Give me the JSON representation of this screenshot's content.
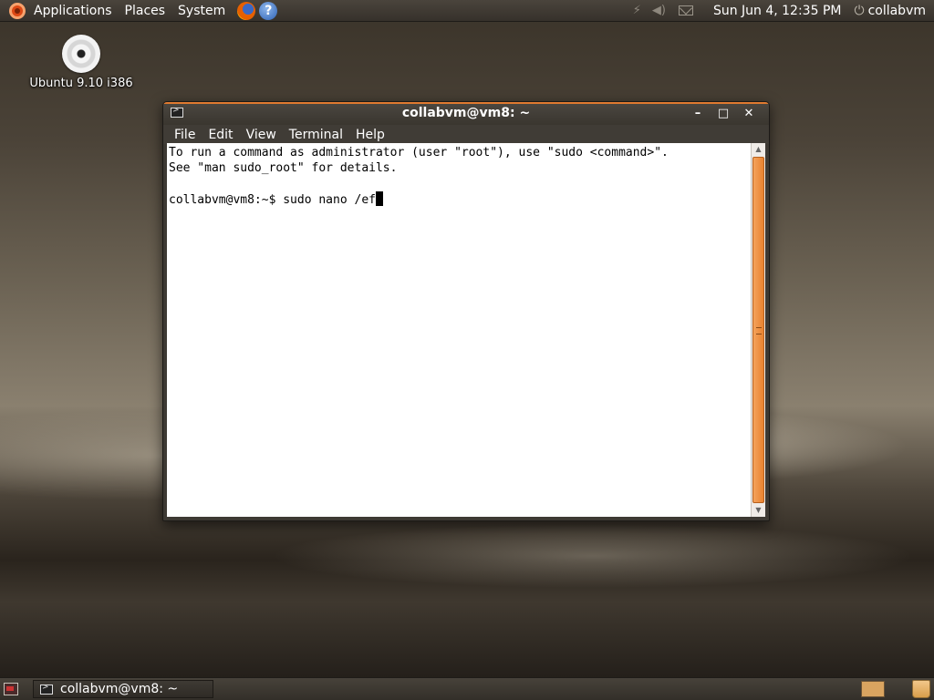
{
  "top_panel": {
    "menus": [
      "Applications",
      "Places",
      "System"
    ],
    "clock": "Sun Jun  4, 12:35 PM",
    "user": "collabvm"
  },
  "desktop": {
    "icon_label": "Ubuntu 9.10 i386"
  },
  "terminal": {
    "title": "collabvm@vm8: ~",
    "menu": [
      "File",
      "Edit",
      "View",
      "Terminal",
      "Help"
    ],
    "lines": [
      "To run a command as administrator (user \"root\"), use \"sudo <command>\".",
      "See \"man sudo_root\" for details.",
      "",
      "collabvm@vm8:~$ sudo nano /ef"
    ],
    "window_controls": {
      "minimize": "–",
      "maximize": "□",
      "close": "✕"
    }
  },
  "bottom_panel": {
    "task_label": "collabvm@vm8: ~"
  },
  "icons": {
    "ubuntu": "ubuntu-logo-icon",
    "browser": "firefox-icon",
    "help": "help-icon",
    "network": "network-icon",
    "volume": "volume-icon",
    "mail": "mail-icon",
    "power": "power-icon",
    "cd": "cd-drive-icon",
    "terminal": "terminal-icon",
    "trash": "trash-icon"
  },
  "colors": {
    "accent": "#e07a30",
    "scroll_thumb": "#f4a35c",
    "panel": "#3c3731"
  }
}
